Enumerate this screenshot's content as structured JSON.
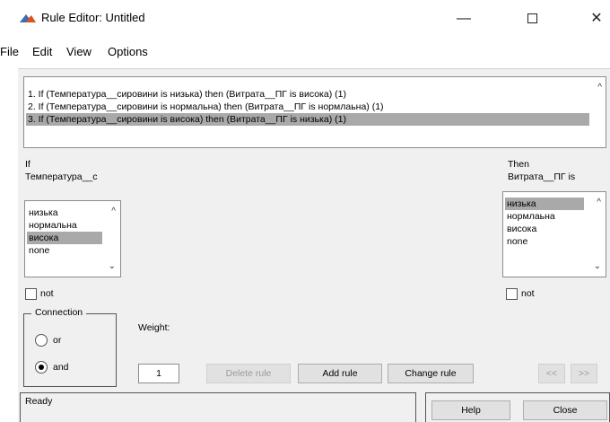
{
  "window": {
    "title": "Rule Editor: Untitled",
    "minimize_glyph": "—",
    "close_glyph": "✕"
  },
  "menu": [
    "File",
    "Edit",
    "View",
    "Options"
  ],
  "rules": [
    "1. If (Температура__сировини is низька) then (Витрата__ПГ is висока) (1)",
    "2. If (Температура__сировини is нормальна) then (Витрата__ПГ is нормлаьна) (1)",
    "3. If (Температура__сировини is висока) then (Витрата__ПГ is низька) (1)"
  ],
  "selected_rule_index": 2,
  "if_section": {
    "label": "If",
    "variable": "Температура__с",
    "options": [
      "низька",
      "нормальна",
      "висока",
      "none"
    ],
    "selected_index": 2,
    "not_label": "not",
    "not_checked": false
  },
  "then_section": {
    "label": "Then",
    "variable": "Витрата__ПГ is",
    "options": [
      "низька",
      "нормлаьна",
      "висока",
      "none"
    ],
    "selected_index": 0,
    "not_label": "not",
    "not_checked": false
  },
  "connection": {
    "legend": "Connection",
    "options": [
      "or",
      "and"
    ],
    "selected": "and"
  },
  "weight": {
    "label": "Weight:",
    "value": "1"
  },
  "buttons": {
    "delete_rule": "Delete rule",
    "add_rule": "Add rule",
    "change_rule": "Change rule",
    "prev": "<<",
    "next": ">>",
    "help": "Help",
    "close": "Close"
  },
  "status": "Ready",
  "icons": {
    "app": "matlab-fuzzy-icon",
    "scroll_up": "chevron-up-icon",
    "scroll_down": "chevron-down-icon"
  },
  "colors": {
    "selection": "#a9a9a9",
    "panel": "#f0f0f0",
    "disabled_text": "#9a9a9a"
  }
}
